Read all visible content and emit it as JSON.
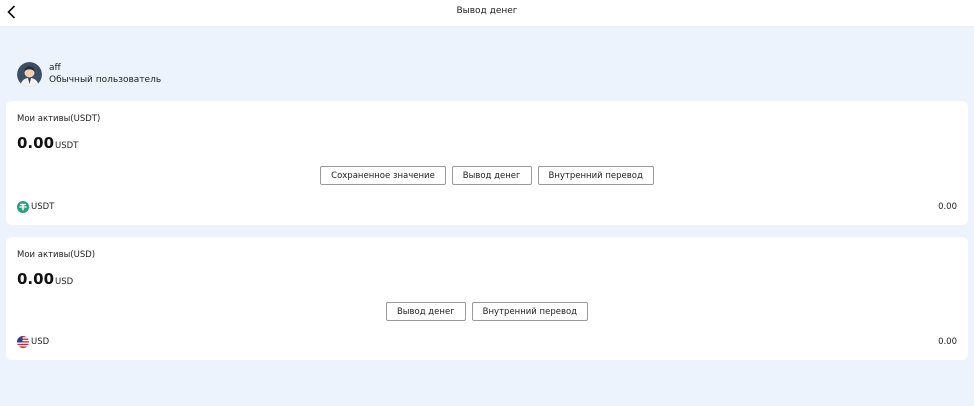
{
  "header": {
    "title": "Вывод денег"
  },
  "user": {
    "name": "aff",
    "role": "Обычный пользователь"
  },
  "cards": [
    {
      "title": "Мои активы(USDT)",
      "balance": "0.00",
      "unit": "USDT",
      "buttons": [
        "Сохраненное значение",
        "Вывод денег",
        "Внутренний перевод"
      ],
      "asset": {
        "label": "USDT",
        "value": "0.00",
        "icon": "tether-icon",
        "color": "#26a17b"
      }
    },
    {
      "title": "Мои активы(USD)",
      "balance": "0.00",
      "unit": "USD",
      "buttons": [
        "Вывод денег",
        "Внутренний перевод"
      ],
      "asset": {
        "label": "USD",
        "value": "0.00",
        "icon": "us-flag-icon"
      }
    }
  ],
  "colors": {
    "background": "#edf3fd",
    "card": "#ffffff",
    "button_border": "#9a9a9a"
  }
}
